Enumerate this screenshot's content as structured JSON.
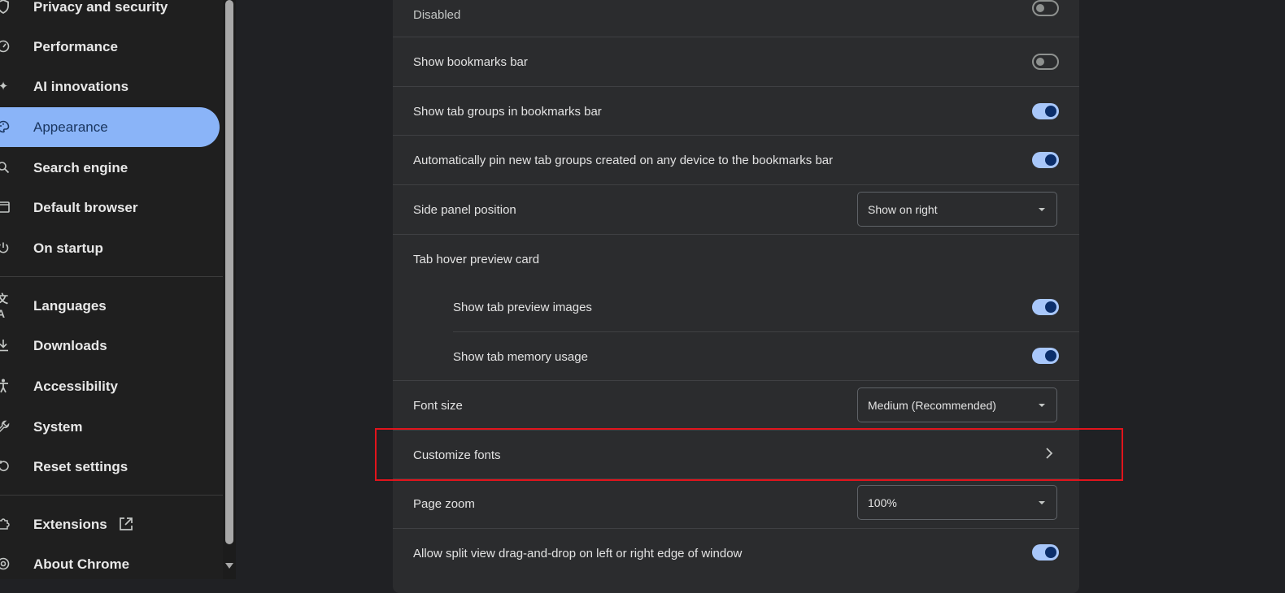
{
  "sidebar": {
    "items": [
      {
        "label": "Privacy and security"
      },
      {
        "label": "Performance"
      },
      {
        "label": "AI innovations"
      },
      {
        "label": "Appearance",
        "active": true
      },
      {
        "label": "Search engine"
      },
      {
        "label": "Default browser"
      },
      {
        "label": "On startup"
      },
      {
        "label": "Languages"
      },
      {
        "label": "Downloads"
      },
      {
        "label": "Accessibility"
      },
      {
        "label": "System"
      },
      {
        "label": "Reset settings"
      },
      {
        "label": "Extensions"
      },
      {
        "label": "About Chrome"
      }
    ]
  },
  "settings": {
    "disabled_status": "Disabled",
    "show_bookmarks_bar": "Show bookmarks bar",
    "show_tab_groups": "Show tab groups in bookmarks bar",
    "auto_pin_tab_groups": "Automatically pin new tab groups created on any device to the bookmarks bar",
    "side_panel_position": "Side panel position",
    "side_panel_value": "Show on right",
    "tab_hover_preview": "Tab hover preview card",
    "show_tab_preview_images": "Show tab preview images",
    "show_tab_memory_usage": "Show tab memory usage",
    "font_size": "Font size",
    "font_size_value": "Medium (Recommended)",
    "customize_fonts": "Customize fonts",
    "page_zoom": "Page zoom",
    "page_zoom_value": "100%",
    "split_view": "Allow split view drag-and-drop on left or right edge of window"
  },
  "toggles": {
    "top_partial": false,
    "show_bookmarks_bar": false,
    "show_tab_groups": true,
    "auto_pin_tab_groups": true,
    "show_tab_preview_images": true,
    "show_tab_memory_usage": true,
    "split_view": true
  },
  "colors": {
    "accent": "#8ab4f8",
    "highlight_box": "#e1141c",
    "background": "#202124",
    "card": "#2b2c2e"
  },
  "icons": {
    "privacy": "shield-icon",
    "performance": "gauge-icon",
    "ai": "sparkle-icon",
    "appearance": "palette-icon",
    "search": "search-icon",
    "default_browser": "window-icon",
    "startup": "power-icon",
    "languages": "translate-icon",
    "downloads": "download-icon",
    "accessibility": "accessibility-icon",
    "system": "wrench-icon",
    "reset": "reset-icon",
    "extensions": "puzzle-icon",
    "about": "chrome-icon"
  }
}
